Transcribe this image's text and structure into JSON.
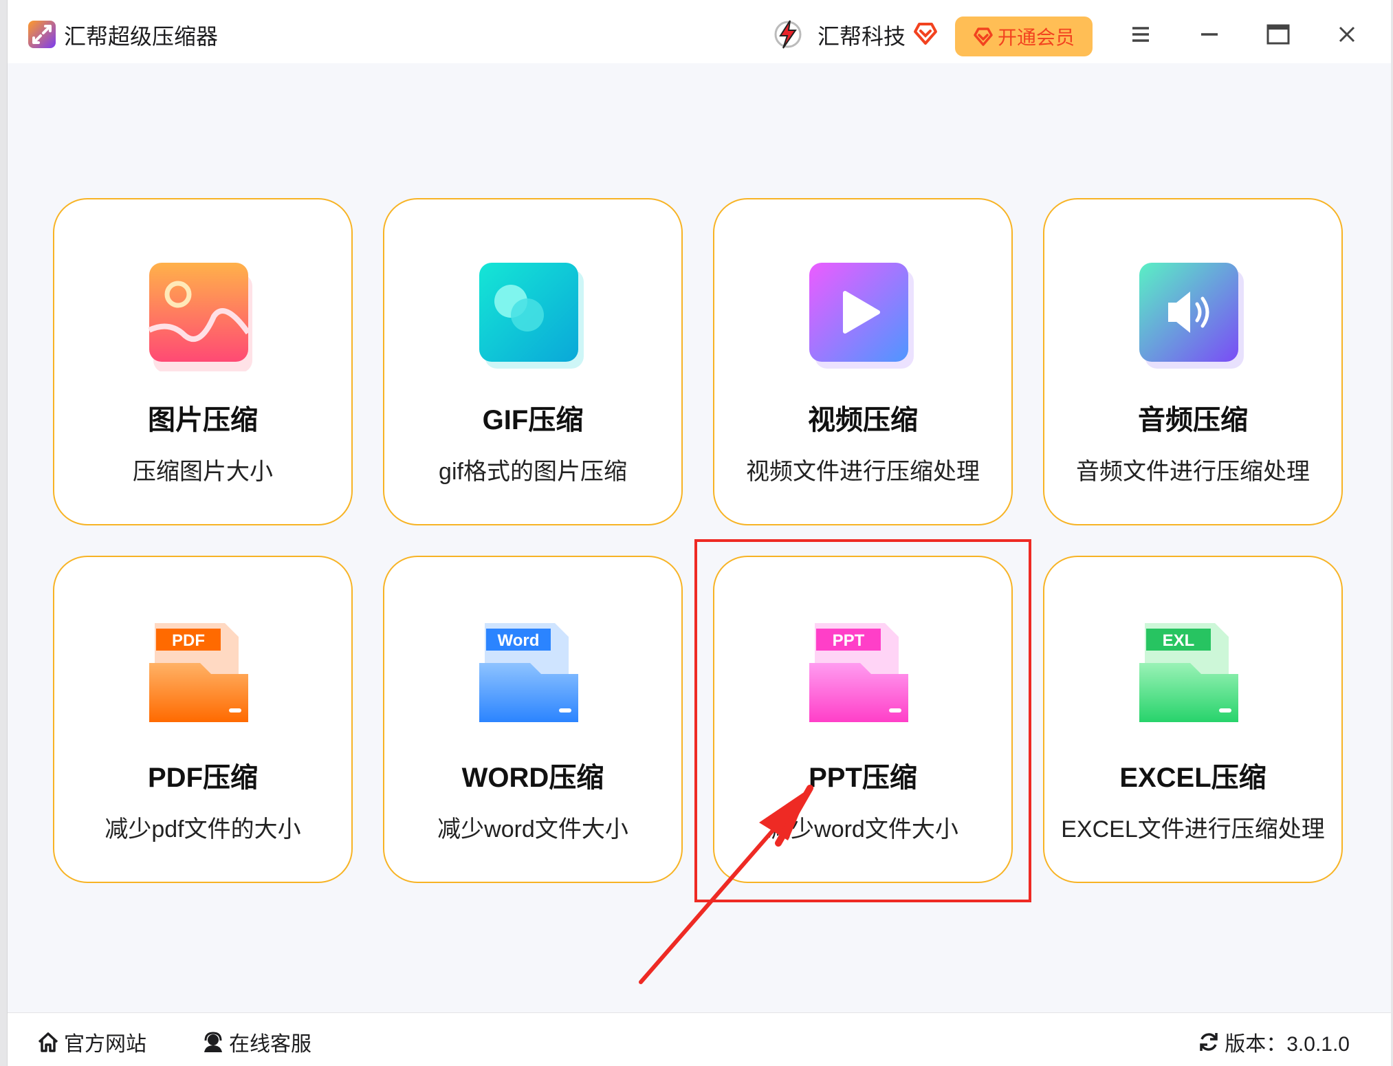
{
  "titlebar": {
    "app_title": "汇帮超级压缩器",
    "brand_name": "汇帮科技",
    "vip_label": "开通会员",
    "controls": [
      "menu-icon",
      "minimize-icon",
      "maximize-icon",
      "close-icon"
    ]
  },
  "cards": [
    {
      "title": "图片压缩",
      "desc": "压缩图片大小",
      "icon": "image-icon"
    },
    {
      "title": "GIF压缩",
      "desc": "gif格式的图片压缩",
      "icon": "gif-icon"
    },
    {
      "title": "视频压缩",
      "desc": "视频文件进行压缩处理",
      "icon": "video-play-icon"
    },
    {
      "title": "音频压缩",
      "desc": "音频文件进行压缩处理",
      "icon": "audio-speaker-icon"
    },
    {
      "title": "PDF压缩",
      "desc": "减少pdf文件的大小",
      "icon": "pdf-folder-icon",
      "tag": "PDF"
    },
    {
      "title": "WORD压缩",
      "desc": "减少word文件大小",
      "icon": "word-folder-icon",
      "tag": "Word"
    },
    {
      "title": "PPT压缩",
      "desc": "减少word文件大小",
      "icon": "ppt-folder-icon",
      "tag": "PPT"
    },
    {
      "title": "EXCEL压缩",
      "desc": "EXCEL文件进行压缩处理",
      "icon": "excel-folder-icon",
      "tag": "EXL"
    }
  ],
  "footer": {
    "website_label": "官方网站",
    "support_label": "在线客服",
    "version_label": "版本：3.0.1.0"
  },
  "colors": {
    "card_border": "#f7b324",
    "vip_bg": "#ffbe55",
    "vip_text": "#f2421f",
    "annotation": "#ee2a24"
  }
}
